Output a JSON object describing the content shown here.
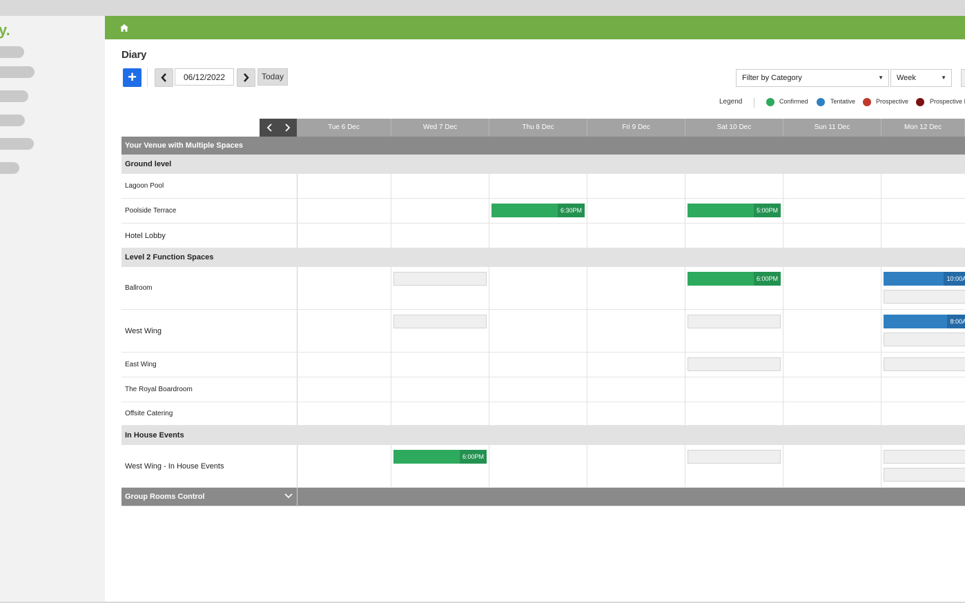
{
  "app": {
    "logo_text": "y.",
    "accent_color": "#72ad45",
    "home_icon": "home-icon"
  },
  "diary": {
    "title": "Diary",
    "add_label": "+",
    "date_value": "06/12/2022",
    "today_label": "Today",
    "filter_label": "Filter by Category",
    "view_label": "Week"
  },
  "legend": {
    "title": "Legend",
    "items": [
      {
        "label": "Confirmed",
        "color": "#2eaa5f"
      },
      {
        "label": "Tentative",
        "color": "#2f7fc1"
      },
      {
        "label": "Prospective",
        "color": "#c0392b"
      },
      {
        "label": "Prospective I",
        "color": "#7a1212"
      }
    ]
  },
  "days": [
    "Tue 6 Dec",
    "Wed 7 Dec",
    "Thu 8 Dec",
    "Fri 9 Dec",
    "Sat 10 Dec",
    "Sun 11 Dec",
    "Mon 12 Dec"
  ],
  "rows": {
    "venue": "Your Venue with Multiple Spaces",
    "ground_level": "Ground level",
    "lagoon_pool": "Lagoon Pool",
    "poolside_terrace": "Poolside Terrace",
    "hotel_lobby": "Hotel Lobby",
    "level2": "Level 2 Function Spaces",
    "ballroom": "Ballroom",
    "west_wing": "West Wing",
    "east_wing": "East Wing",
    "royal_boardroom": "The Royal Boardroom",
    "offsite_catering": "Offsite Catering",
    "in_house": "In House Events",
    "west_wing_in_house": "West Wing - In House Events",
    "group_rooms": "Group Rooms Control"
  },
  "bookings": {
    "terrace_thu": "6:30PM",
    "terrace_sat": "5:00PM",
    "ballroom_sat": "6:00PM",
    "ballroom_mon": "10:00A",
    "westwing_mon": "8:00A",
    "inhouse_wed": "6:00PM"
  }
}
